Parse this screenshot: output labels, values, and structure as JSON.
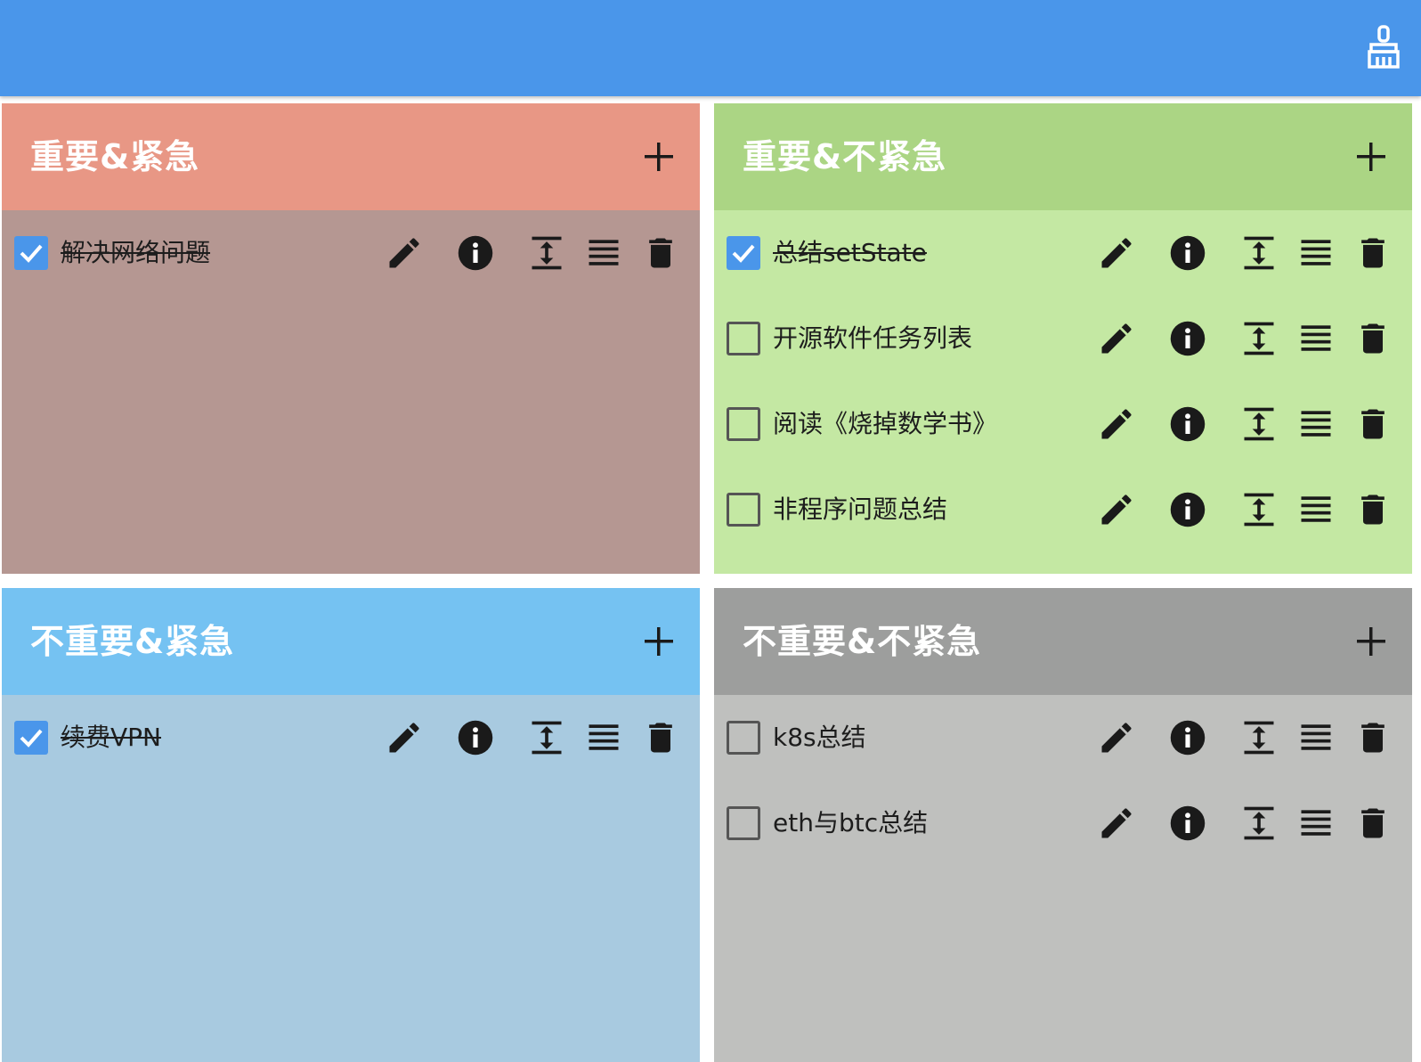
{
  "toolbar": {
    "clear_icon": "broom-icon"
  },
  "colors": {
    "appbar": "#4a96ea",
    "checkbox_checked": "#4a96ea",
    "icon": "#1a1a1a"
  },
  "quadrants": [
    {
      "title": "重要&紧急",
      "header_color": "#e89785",
      "body_color": "#b59792",
      "tasks": [
        {
          "text": "解决网络问题",
          "done": true
        }
      ]
    },
    {
      "title": "重要&不紧急",
      "header_color": "#abd584",
      "body_color": "#c4e8a3",
      "tasks": [
        {
          "text": "总结setState",
          "done": true
        },
        {
          "text": "开源软件任务列表",
          "done": false
        },
        {
          "text": "阅读《烧掉数学书》",
          "done": false
        },
        {
          "text": "非程序问题总结",
          "done": false
        }
      ]
    },
    {
      "title": "不重要&紧急",
      "header_color": "#75c2f2",
      "body_color": "#a8cae0",
      "tasks": [
        {
          "text": "续费VPN",
          "done": true
        }
      ]
    },
    {
      "title": "不重要&不紧急",
      "header_color": "#9d9e9d",
      "body_color": "#bfc0be",
      "tasks": [
        {
          "text": "k8s总结",
          "done": false
        },
        {
          "text": "eth与btc总结",
          "done": false
        }
      ]
    }
  ],
  "row_actions": [
    "edit-icon",
    "info-icon",
    "expand-icon",
    "details-icon",
    "delete-icon"
  ]
}
